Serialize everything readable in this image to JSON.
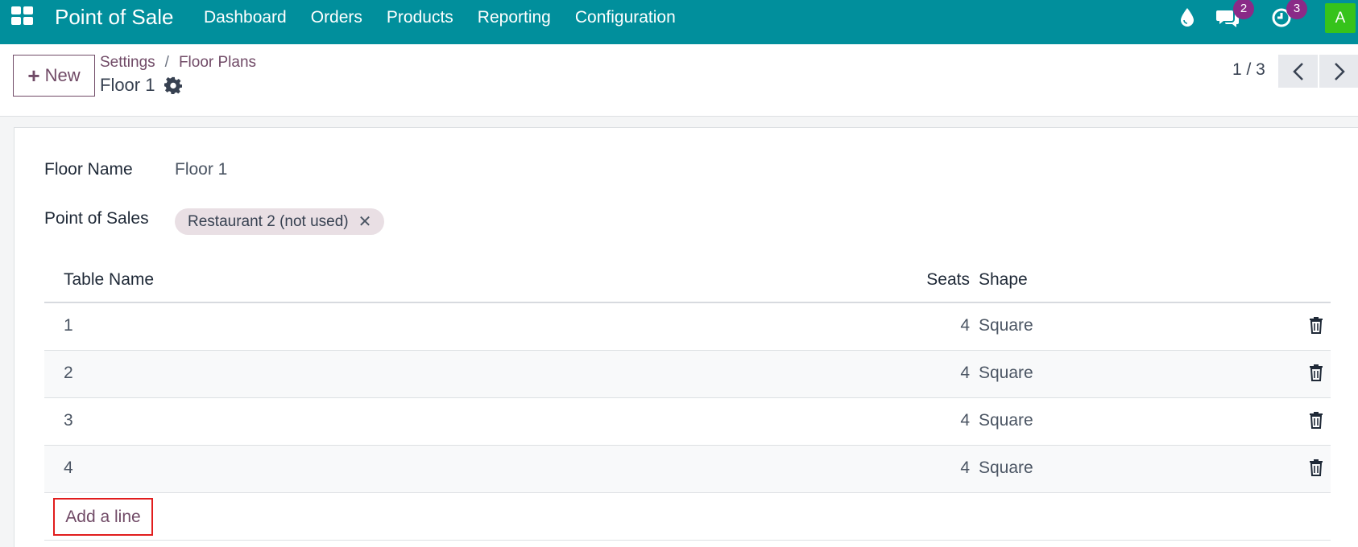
{
  "navbar": {
    "app_name": "Point of Sale",
    "menu": [
      "Dashboard",
      "Orders",
      "Products",
      "Reporting",
      "Configuration"
    ],
    "messages_count": "2",
    "activities_count": "3",
    "avatar_letter": "A",
    "colors": {
      "navbar": "#018f9c",
      "badge": "#8a2a87",
      "avatar": "#36c31b"
    }
  },
  "control": {
    "new_label": "New",
    "breadcrumb": [
      "Settings",
      "Floor Plans"
    ],
    "record_title": "Floor 1",
    "pager": "1 / 3"
  },
  "form": {
    "floor_name_label": "Floor Name",
    "floor_name_value": "Floor 1",
    "pos_label": "Point of Sales",
    "pos_tags": [
      "Restaurant 2 (not used)"
    ]
  },
  "table": {
    "columns": [
      "Table Name",
      "Seats",
      "Shape"
    ],
    "rows": [
      {
        "name": "1",
        "seats": "4",
        "shape": "Square"
      },
      {
        "name": "2",
        "seats": "4",
        "shape": "Square"
      },
      {
        "name": "3",
        "seats": "4",
        "shape": "Square"
      },
      {
        "name": "4",
        "seats": "4",
        "shape": "Square"
      }
    ],
    "add_line_label": "Add a line"
  }
}
